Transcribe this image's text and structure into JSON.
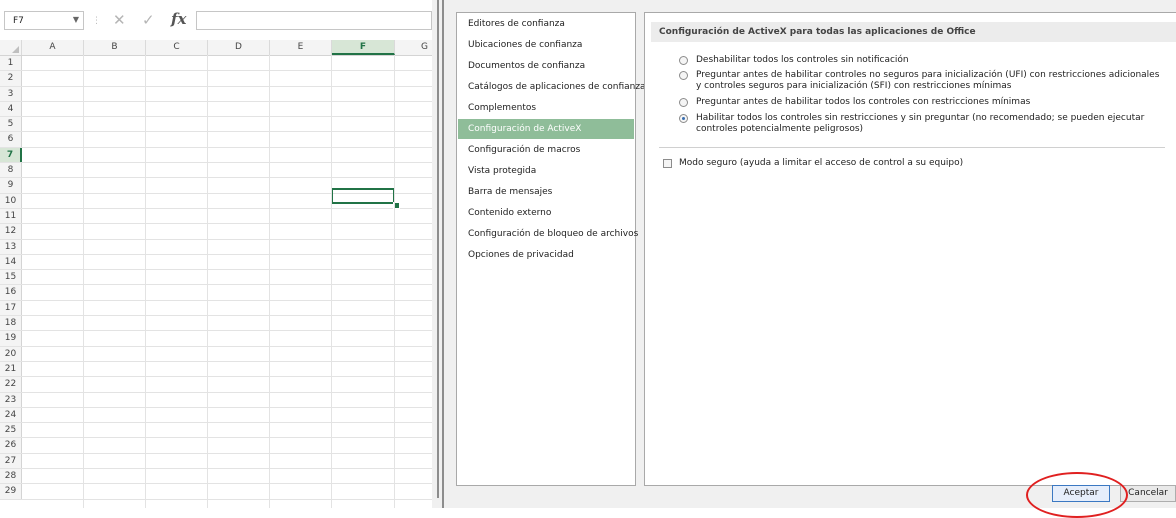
{
  "excel": {
    "name_box": "F7",
    "columns": [
      "A",
      "B",
      "C",
      "D",
      "E",
      "F",
      "G"
    ],
    "active_column": "F",
    "rows": [
      "1",
      "2",
      "3",
      "4",
      "5",
      "6",
      "7",
      "8",
      "9",
      "10",
      "11",
      "12",
      "13",
      "14",
      "15",
      "16",
      "17",
      "18",
      "19",
      "20",
      "21",
      "22",
      "23",
      "24",
      "25",
      "26",
      "27",
      "28",
      "29"
    ],
    "active_row": "7",
    "formula_value": ""
  },
  "trust_center": {
    "nav_items": [
      "Editores de confianza",
      "Ubicaciones de confianza",
      "Documentos de confianza",
      "Catálogos de aplicaciones de confianza",
      "Complementos",
      "Configuración de ActiveX",
      "Configuración de macros",
      "Vista protegida",
      "Barra de mensajes",
      "Contenido externo",
      "Configuración de bloqueo de archivos",
      "Opciones de privacidad"
    ],
    "selected_nav": "Configuración de ActiveX",
    "section_title": "Configuración de ActiveX para todas las aplicaciones de Office",
    "options": [
      {
        "label": "Deshabilitar todos los controles sin notificación",
        "checked": false
      },
      {
        "label": "Preguntar antes de habilitar controles no seguros para inicialización (UFI) con restricciones adicionales y controles seguros para inicialización (SFI) con restricciones mínimas",
        "checked": false
      },
      {
        "label": "Preguntar antes de habilitar todos los controles con restricciones mínimas",
        "checked": false
      },
      {
        "label": "Habilitar todos los controles sin restricciones y sin preguntar (no recomendado; se pueden ejecutar controles potencialmente peligrosos)",
        "checked": true
      }
    ],
    "safe_mode_label": "Modo seguro (ayuda a limitar el acceso de control a su equipo)",
    "safe_mode_checked": false,
    "ok_label": "Aceptar",
    "cancel_label": "Cancelar"
  },
  "colors": {
    "excel_green": "#217346",
    "nav_selected": "#8fbd99",
    "highlight_red": "#e02020"
  }
}
